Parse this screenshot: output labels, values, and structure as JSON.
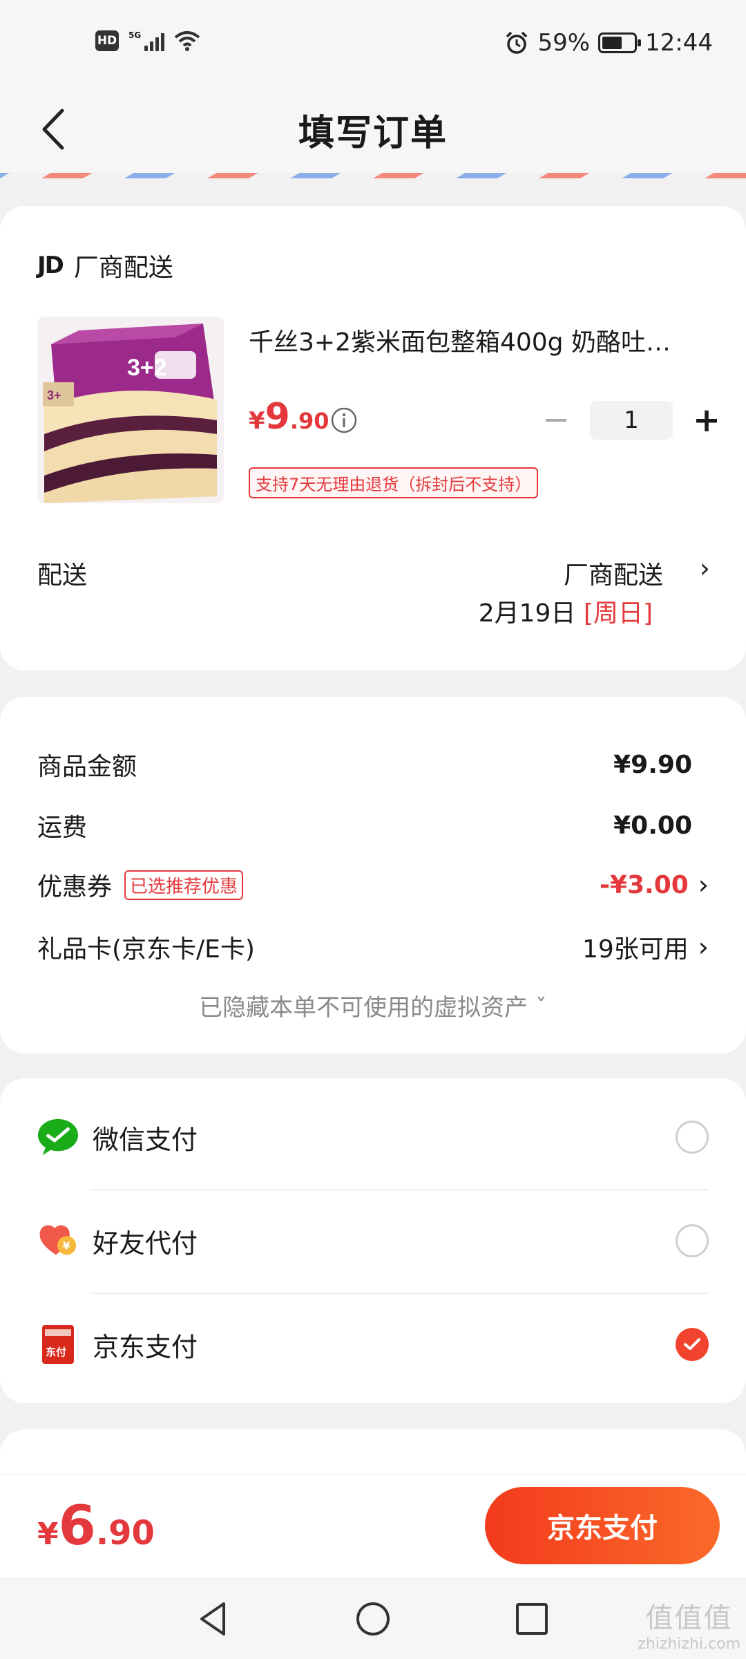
{
  "status_bar": {
    "hd": "HD",
    "network": "5G",
    "battery": "59%",
    "time": "12:44"
  },
  "nav": {
    "title": "填写订单"
  },
  "shop": {
    "logo": "JD",
    "name": "厂商配送"
  },
  "product": {
    "title": "千丝3+2紫米面包整箱400g 奶酪吐…",
    "price_symbol": "¥",
    "price_int": "9",
    "price_dec": ".90",
    "quantity": "1",
    "return_policy": "支持7天无理由退货（拆封后不支持）",
    "image_text": "3+2"
  },
  "delivery": {
    "label": "配送",
    "method": "厂商配送",
    "date": "2月19日",
    "weekday": "[周日]"
  },
  "summary": {
    "goods_label": "商品金额",
    "goods_value": "¥9.90",
    "shipping_label": "运费",
    "shipping_value": "¥0.00",
    "coupon_label": "优惠券",
    "coupon_tag": "已选推荐优惠",
    "coupon_value": "-¥3.00",
    "giftcard_label": "礼品卡(京东卡/E卡)",
    "giftcard_value": "19张可用",
    "hidden_note": "已隐藏本单不可使用的虚拟资产 ˇ"
  },
  "payment": {
    "methods": [
      {
        "label": "微信支付",
        "icon": "wechat-pay-icon",
        "selected": false
      },
      {
        "label": "好友代付",
        "icon": "friend-pay-icon",
        "selected": false
      },
      {
        "label": "京东支付",
        "icon": "jd-pay-icon",
        "selected": true
      }
    ],
    "jd_icon_text": "东付"
  },
  "bottom": {
    "total_symbol": "¥",
    "total_int": "6",
    "total_dec": ".90",
    "pay_button": "京东支付"
  },
  "watermark": {
    "top": "值值值",
    "bottom": "zhizhizhi.com"
  },
  "colors": {
    "accent": "#e4393c",
    "button": "#f23a1d",
    "wechat": "#1aad19"
  }
}
